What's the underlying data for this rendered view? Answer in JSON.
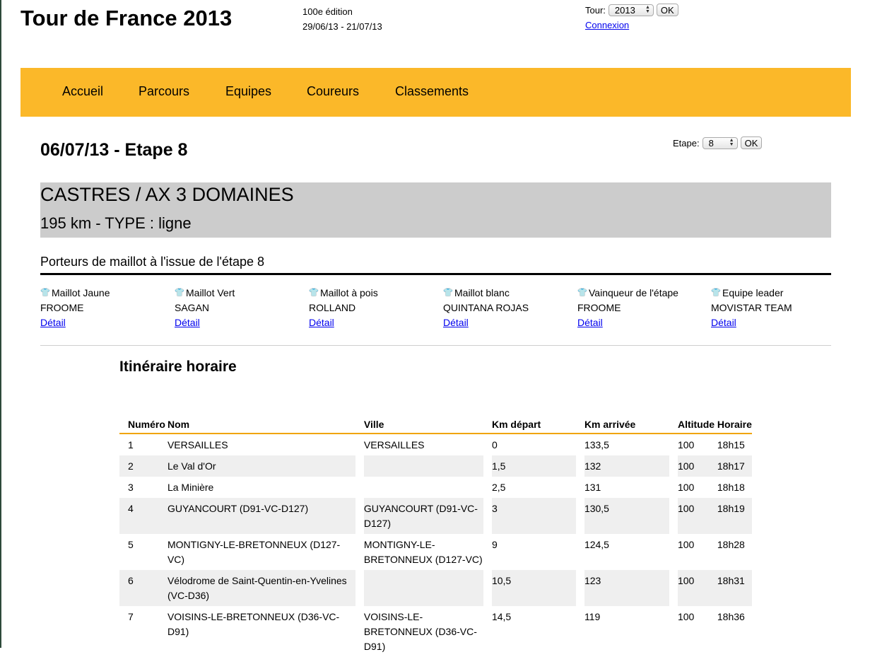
{
  "header": {
    "title": "Tour de France 2013",
    "edition": "100e édition",
    "dates": "29/06/13 - 21/07/13",
    "tour_label": "Tour:",
    "tour_value": "2013",
    "tour_ok": "OK",
    "login": "Connexion"
  },
  "nav": [
    "Accueil",
    "Parcours",
    "Equipes",
    "Coureurs",
    "Classements"
  ],
  "stage": {
    "title": "06/07/13 - Etape 8",
    "select_label": "Etape:",
    "select_value": "8",
    "ok": "OK",
    "route": "CASTRES / AX 3 DOMAINES",
    "info": "195 km - TYPE : ligne"
  },
  "jerseys": {
    "heading": "Porteurs de maillot à l'issue de l'étape 8",
    "detail_label": "Détail",
    "items": [
      {
        "label": "Maillot Jaune",
        "holder": "FROOME",
        "icon": "yellow-jersey-icon",
        "color": "#e8d21c"
      },
      {
        "label": "Maillot Vert",
        "holder": "SAGAN",
        "icon": "green-jersey-icon",
        "color": "#2fa83a"
      },
      {
        "label": "Maillot à pois",
        "holder": "ROLLAND",
        "icon": "polka-dot-jersey-icon",
        "color": "#d62b2b"
      },
      {
        "label": "Maillot blanc",
        "holder": "QUINTANA ROJAS",
        "icon": "white-jersey-icon",
        "color": "#ffffff"
      },
      {
        "label": "Vainqueur de l'étape",
        "holder": "FROOME",
        "icon": "stage-winner-jersey-icon",
        "color": "#b0501e"
      },
      {
        "label": "Equipe leader",
        "holder": "MOVISTAR TEAM",
        "icon": "team-leader-jersey-icon",
        "color": "#e8d21c"
      }
    ]
  },
  "itinerary": {
    "title": "Itinéraire horaire",
    "headers": [
      "Numéro",
      "Nom",
      "Ville",
      "Km départ",
      "Km arrivée",
      "Altitude",
      "Horaire"
    ],
    "rows": [
      [
        "1",
        "VERSAILLES",
        "VERSAILLES",
        "0",
        "133,5",
        "100",
        "18h15"
      ],
      [
        "2",
        "Le Val d'Or",
        "",
        "1,5",
        "132",
        "100",
        "18h17"
      ],
      [
        "3",
        "La Minière",
        "",
        "2,5",
        "131",
        "100",
        "18h18"
      ],
      [
        "4",
        "GUYANCOURT (D91-VC-D127)",
        "GUYANCOURT (D91-VC-D127)",
        "3",
        "130,5",
        "100",
        "18h19"
      ],
      [
        "5",
        "MONTIGNY-LE-BRETONNEUX (D127-VC)",
        "MONTIGNY-LE-BRETONNEUX (D127-VC)",
        "9",
        "124,5",
        "100",
        "18h28"
      ],
      [
        "6",
        "Vélodrome de Saint-Quentin-en-Yvelines (VC-D36)",
        "",
        "10,5",
        "123",
        "100",
        "18h31"
      ],
      [
        "7",
        "VOISINS-LE-BRETONNEUX (D36-VC-D91)",
        "VOISINS-LE-BRETONNEUX (D36-VC-D91)",
        "14,5",
        "119",
        "100",
        "18h36"
      ]
    ]
  }
}
